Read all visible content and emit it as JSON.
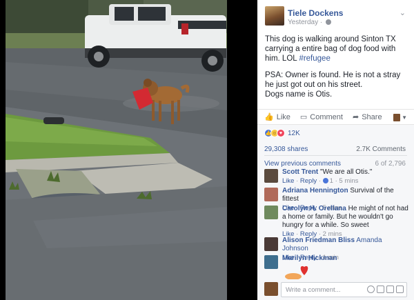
{
  "post": {
    "author": "Tiele Dockens",
    "time": "Yesterday · ",
    "line1": "This dog is walking around Sinton TX carrying a entire bag of dog food with him. LOL ",
    "hashtag": "#refugee",
    "line2": "PSA: Owner is found. He is not a stray he just got out on his street.",
    "line3": "Dogs name is Otis."
  },
  "actions": {
    "like": "Like",
    "comment": "Comment",
    "share": "Share"
  },
  "feedback": {
    "reaction_count": "12K",
    "shares": "29,308 shares",
    "comments_count": "2.7K Comments",
    "view_previous": "View previous comments",
    "position": "6 of 2,796"
  },
  "comments": [
    {
      "name": "Scott Trent",
      "text": " \"We are all Otis.\"",
      "like": "Like",
      "reply": "Reply",
      "likes": "1",
      "time": "5 mins"
    },
    {
      "name": "Adriana Hennington",
      "text": " Survival of the fittest",
      "like": "Like",
      "reply": "Reply",
      "time": "5 mins"
    },
    {
      "name": "Carolyn H. Orellana",
      "text": " He might of not had a home or family. But he wouldn't go hungry for a while. So sweet",
      "like": "Like",
      "reply": "Reply",
      "time": "2 mins"
    },
    {
      "name": "Alison Friedman Bliss",
      "tag": " Amanda Johnson",
      "like": "Like",
      "reply": "Reply",
      "time": "1 min"
    },
    {
      "name": "Marilyn Hickman"
    }
  ],
  "composer": {
    "placeholder": "Write a comment..."
  },
  "colors": {
    "link": "#365899",
    "muted": "#90949c",
    "feedback_bg": "#f6f7f9"
  }
}
